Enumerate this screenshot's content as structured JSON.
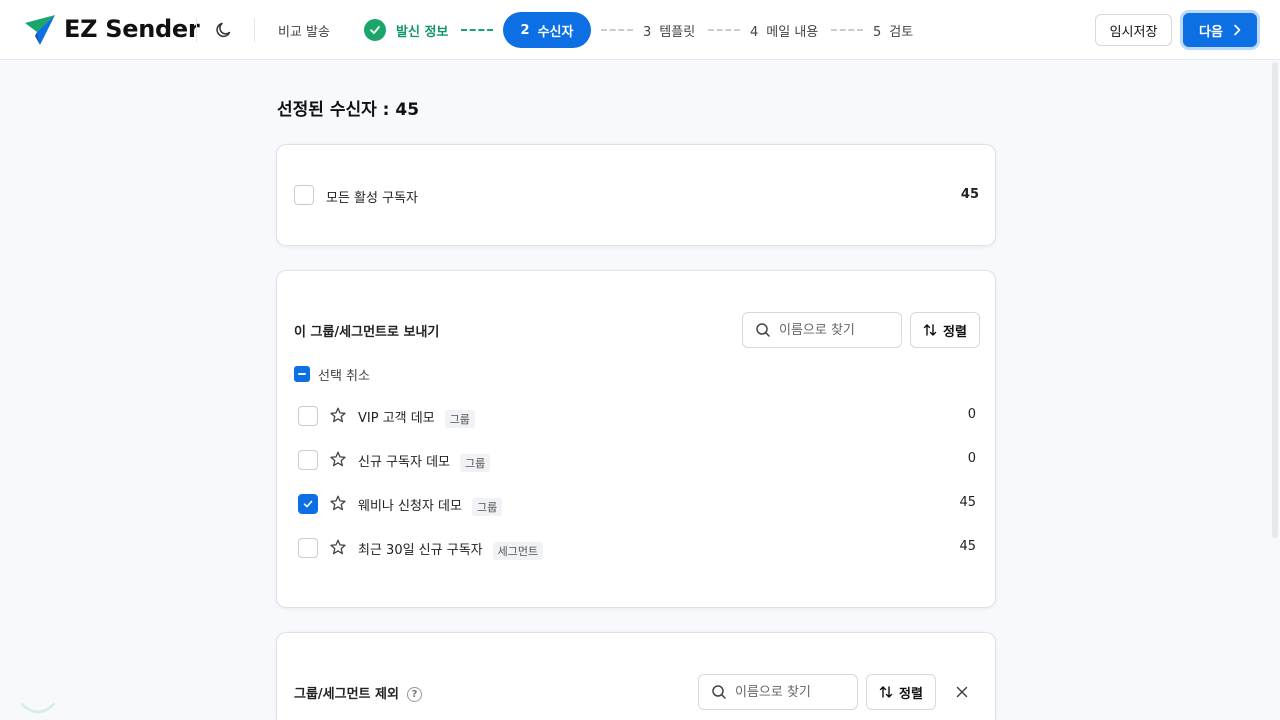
{
  "header": {
    "brand": "EZ Sender",
    "compare_send": "비교 발송",
    "steps": [
      {
        "num": "",
        "label": "발신 정보",
        "state": "done"
      },
      {
        "num": "2",
        "label": "수신자",
        "state": "active"
      },
      {
        "num": "3",
        "label": "템플릿",
        "state": "pending"
      },
      {
        "num": "4",
        "label": "메일 내용",
        "state": "pending"
      },
      {
        "num": "5",
        "label": "검토",
        "state": "pending"
      }
    ],
    "draft_label": "임시저장",
    "next_label": "다음"
  },
  "colors": {
    "accent": "#0c6fe4",
    "success": "#1aa66b"
  },
  "main": {
    "selected_title": "선정된 수신자 : 45",
    "all_subscribers": {
      "label": "모든 활성 구독자",
      "count": "45",
      "checked": false
    },
    "send_groups": {
      "title": "이 그룹/세그먼트로 보내기",
      "search_placeholder": "이름으로 찾기",
      "sort_label": "정렬",
      "deselect_label": "선택 취소",
      "items": [
        {
          "name": "VIP 고객 데모",
          "tag": "그룹",
          "count": "0",
          "checked": false
        },
        {
          "name": "신규 구독자 데모",
          "tag": "그룹",
          "count": "0",
          "checked": false
        },
        {
          "name": "웨비나 신청자 데모",
          "tag": "그룹",
          "count": "45",
          "checked": true
        },
        {
          "name": "최근 30일 신규 구독자",
          "tag": "세그먼트",
          "count": "45",
          "checked": false
        }
      ]
    },
    "exclude_groups": {
      "title": "그룹/세그먼트 제외",
      "help": "?",
      "search_placeholder": "이름으로 찾기",
      "sort_label": "정렬"
    }
  }
}
